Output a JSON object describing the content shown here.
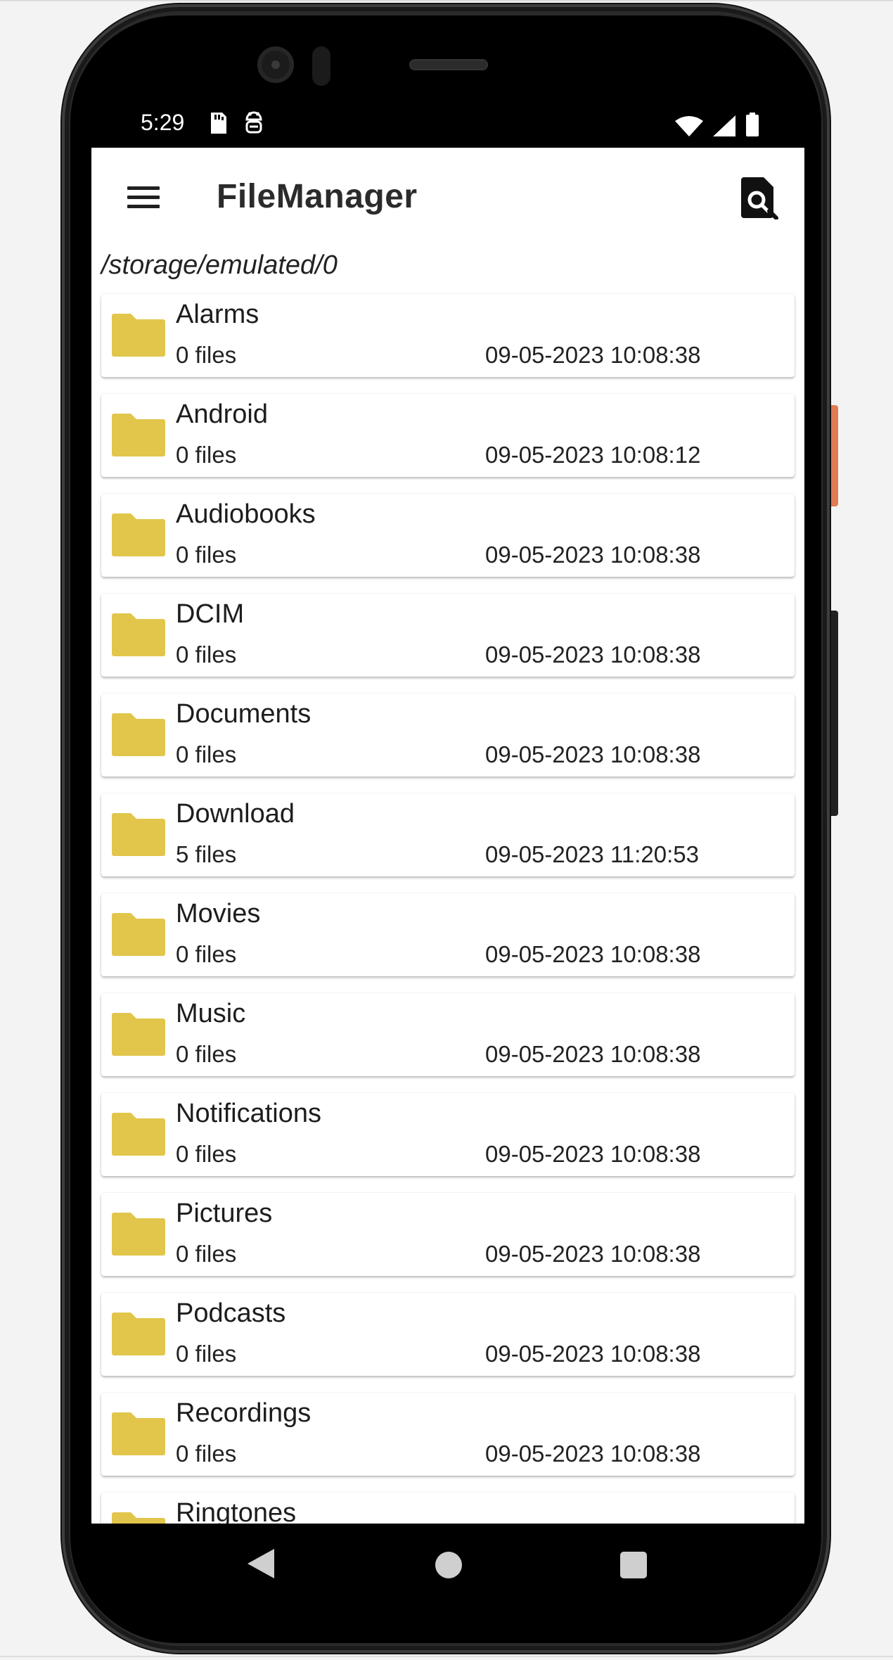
{
  "status_bar": {
    "time": "5:29",
    "left_icons": [
      "sd-card-icon",
      "android-debug-icon"
    ],
    "right_icons": [
      "wifi-icon",
      "signal-icon",
      "battery-icon"
    ]
  },
  "app_bar": {
    "title": "FileManager",
    "menu_icon": "hamburger-menu-icon",
    "search_icon": "file-search-icon"
  },
  "path": "/storage/emulated/0",
  "folder_color": "#e2c64b",
  "folders": [
    {
      "name": "Alarms",
      "count": "0 files",
      "date": "09-05-2023 10:08:38"
    },
    {
      "name": "Android",
      "count": "0 files",
      "date": "09-05-2023 10:08:12"
    },
    {
      "name": "Audiobooks",
      "count": "0 files",
      "date": "09-05-2023 10:08:38"
    },
    {
      "name": "DCIM",
      "count": "0 files",
      "date": "09-05-2023 10:08:38"
    },
    {
      "name": "Documents",
      "count": "0 files",
      "date": "09-05-2023 10:08:38"
    },
    {
      "name": "Download",
      "count": "5 files",
      "date": "09-05-2023 11:20:53"
    },
    {
      "name": "Movies",
      "count": "0 files",
      "date": "09-05-2023 10:08:38"
    },
    {
      "name": "Music",
      "count": "0 files",
      "date": "09-05-2023 10:08:38"
    },
    {
      "name": "Notifications",
      "count": "0 files",
      "date": "09-05-2023 10:08:38"
    },
    {
      "name": "Pictures",
      "count": "0 files",
      "date": "09-05-2023 10:08:38"
    },
    {
      "name": "Podcasts",
      "count": "0 files",
      "date": "09-05-2023 10:08:38"
    },
    {
      "name": "Recordings",
      "count": "0 files",
      "date": "09-05-2023 10:08:38"
    },
    {
      "name": "Ringtones",
      "count": "",
      "date": ""
    }
  ],
  "nav_bar": {
    "back_icon": "back-triangle-icon",
    "home_icon": "home-circle-icon",
    "recents_icon": "recents-square-icon"
  }
}
